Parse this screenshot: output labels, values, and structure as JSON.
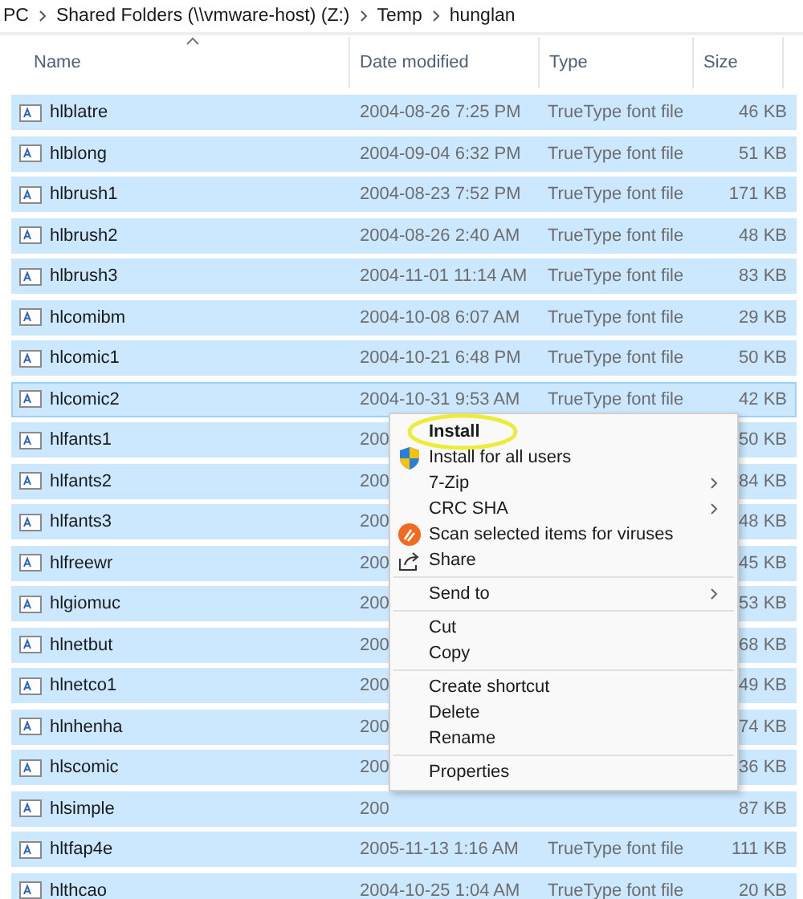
{
  "breadcrumb": [
    "PC",
    "Shared Folders (\\\\vmware-host) (Z:)",
    "Temp",
    "hunglan"
  ],
  "table": {
    "columns": [
      {
        "label": "Name",
        "sorted": true
      },
      {
        "label": "Date modified",
        "sorted": false
      },
      {
        "label": "Type",
        "sorted": false
      },
      {
        "label": "Size",
        "sorted": false
      }
    ],
    "rows": [
      {
        "name": "hlblatre",
        "date": "2004-08-26 7:25 PM",
        "type": "TrueType font file",
        "size": "46 KB",
        "selected": true,
        "focused": false
      },
      {
        "name": "hlblong",
        "date": "2004-09-04 6:32 PM",
        "type": "TrueType font file",
        "size": "51 KB",
        "selected": true,
        "focused": false
      },
      {
        "name": "hlbrush1",
        "date": "2004-08-23 7:52 PM",
        "type": "TrueType font file",
        "size": "171 KB",
        "selected": true,
        "focused": false
      },
      {
        "name": "hlbrush2",
        "date": "2004-08-26 2:40 AM",
        "type": "TrueType font file",
        "size": "48 KB",
        "selected": true,
        "focused": false
      },
      {
        "name": "hlbrush3",
        "date": "2004-11-01 11:14 AM",
        "type": "TrueType font file",
        "size": "83 KB",
        "selected": true,
        "focused": false
      },
      {
        "name": "hlcomibm",
        "date": "2004-10-08 6:07 AM",
        "type": "TrueType font file",
        "size": "29 KB",
        "selected": true,
        "focused": false
      },
      {
        "name": "hlcomic1",
        "date": "2004-10-21 6:48 PM",
        "type": "TrueType font file",
        "size": "50 KB",
        "selected": true,
        "focused": false
      },
      {
        "name": "hlcomic2",
        "date": "2004-10-31 9:53 AM",
        "type": "TrueType font file",
        "size": "42 KB",
        "selected": true,
        "focused": true
      },
      {
        "name": "hlfants1",
        "date": "200",
        "size": "50 KB",
        "selected": true,
        "focused": false
      },
      {
        "name": "hlfants2",
        "date": "200",
        "size": "84 KB",
        "selected": true,
        "focused": false
      },
      {
        "name": "hlfants3",
        "date": "200",
        "size": "48 KB",
        "selected": true,
        "focused": false
      },
      {
        "name": "hlfreewr",
        "date": "200",
        "size": "45 KB",
        "selected": true,
        "focused": false
      },
      {
        "name": "hlgiomuc",
        "date": "200",
        "size": "53 KB",
        "selected": true,
        "focused": false
      },
      {
        "name": "hlnetbut",
        "date": "200",
        "size": "68 KB",
        "selected": true,
        "focused": false
      },
      {
        "name": "hlnetco1",
        "date": "200",
        "size": "49 KB",
        "selected": true,
        "focused": false
      },
      {
        "name": "hlnhenha",
        "date": "200",
        "size": "74 KB",
        "selected": true,
        "focused": false
      },
      {
        "name": "hlscomic",
        "date": "200",
        "size": "36 KB",
        "selected": true,
        "focused": false
      },
      {
        "name": "hlsimple",
        "date": "200",
        "size": "87 KB",
        "selected": true,
        "focused": false
      },
      {
        "name": "hltfap4e",
        "date": "2005-11-13 1:16 AM",
        "type": "TrueType font file",
        "size": "111 KB",
        "selected": true,
        "focused": false
      },
      {
        "name": "hlthcao",
        "date": "2004-10-25 1:04 AM",
        "type": "TrueType font file",
        "size": "20 KB",
        "selected": true,
        "focused": false
      }
    ]
  },
  "context_menu": {
    "groups": [
      [
        {
          "label": "Install",
          "default": true,
          "highlighted": true,
          "submenu": false
        },
        {
          "label": "Install for all users",
          "default": false,
          "highlighted": false,
          "submenu": false
        },
        {
          "label": "7-Zip",
          "default": false,
          "highlighted": false,
          "submenu": true
        },
        {
          "label": "CRC SHA",
          "default": false,
          "highlighted": false,
          "submenu": true
        },
        {
          "label": "Scan selected items for viruses",
          "default": false,
          "highlighted": false,
          "submenu": false
        },
        {
          "label": "Share",
          "default": false,
          "highlighted": false,
          "submenu": false
        }
      ],
      [
        {
          "label": "Send to",
          "default": false,
          "highlighted": false,
          "submenu": true
        }
      ],
      [
        {
          "label": "Cut",
          "default": false,
          "highlighted": false,
          "submenu": false
        },
        {
          "label": "Copy",
          "default": false,
          "highlighted": false,
          "submenu": false
        }
      ],
      [
        {
          "label": "Create shortcut",
          "default": false,
          "highlighted": false,
          "submenu": false
        },
        {
          "label": "Delete",
          "default": false,
          "highlighted": false,
          "submenu": false
        },
        {
          "label": "Rename",
          "default": false,
          "highlighted": false,
          "submenu": false
        }
      ],
      [
        {
          "label": "Properties",
          "default": false,
          "highlighted": false,
          "submenu": false
        }
      ]
    ]
  }
}
